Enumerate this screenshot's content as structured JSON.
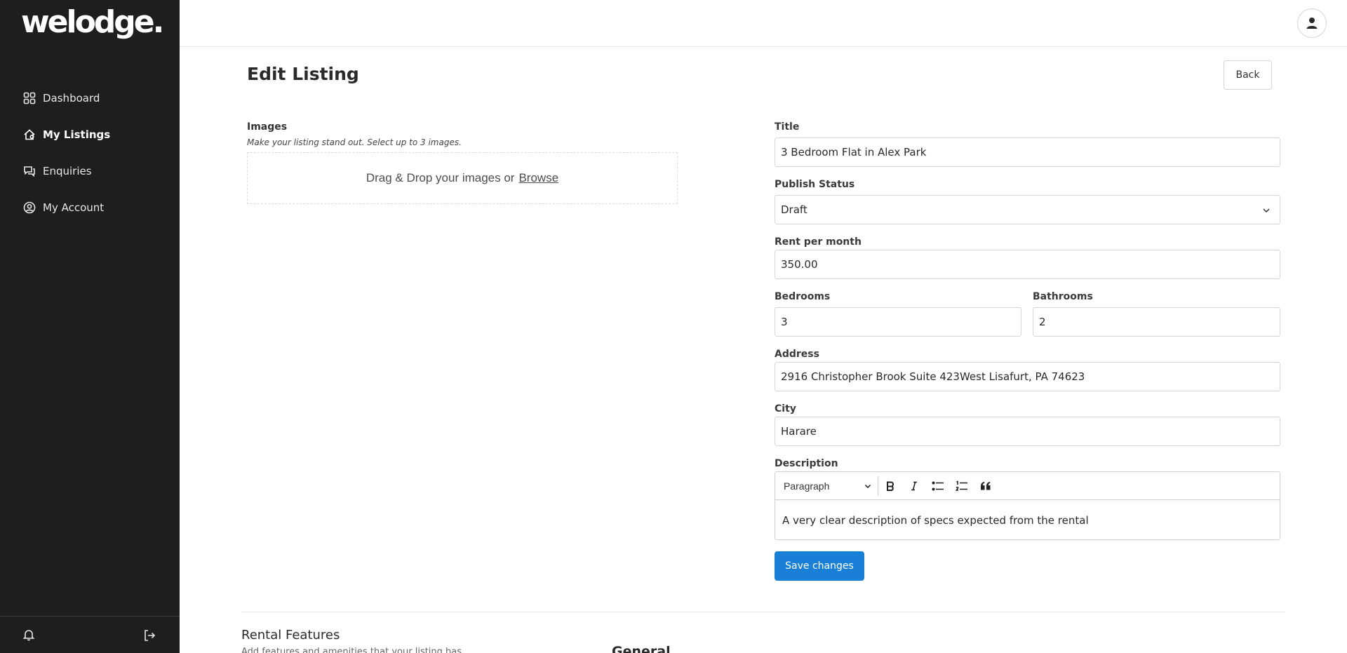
{
  "brand": {
    "logo_text": "welodge."
  },
  "sidebar": {
    "items": [
      {
        "label": "Dashboard",
        "icon": "dashboard-icon"
      },
      {
        "label": "My Listings",
        "icon": "listings-icon"
      },
      {
        "label": "Enquiries",
        "icon": "enquiries-icon"
      },
      {
        "label": "My Account",
        "icon": "account-icon"
      }
    ],
    "active": "My Listings"
  },
  "page": {
    "title": "Edit Listing",
    "back_label": "Back"
  },
  "images": {
    "label": "Images",
    "hint": "Make your listing stand out. Select up to 3 images.",
    "dropzone_text": "Drag & Drop your images or",
    "browse_label": "Browse"
  },
  "form": {
    "title": {
      "label": "Title",
      "value": "3 Bedroom Flat in Alex Park"
    },
    "publish_status": {
      "label": "Publish Status",
      "value": "Draft"
    },
    "rent": {
      "label": "Rent per month",
      "value": "350.00"
    },
    "bedrooms": {
      "label": "Bedrooms",
      "value": "3"
    },
    "bathrooms": {
      "label": "Bathrooms",
      "value": "2"
    },
    "address": {
      "label": "Address",
      "value": "2916 Christopher Brook Suite 423West Lisafurt, PA 74623"
    },
    "city": {
      "label": "City",
      "value": "Harare"
    },
    "description": {
      "label": "Description",
      "block_format": "Paragraph",
      "value": "A very clear description of specs expected from the rental"
    },
    "save_label": "Save changes"
  },
  "features": {
    "title": "Rental Features",
    "hint": "Add features and amenities that your listing has",
    "general_title": "General"
  },
  "colors": {
    "sidebar_bg": "#1e1e1e",
    "primary_button": "#1a7fd6"
  }
}
